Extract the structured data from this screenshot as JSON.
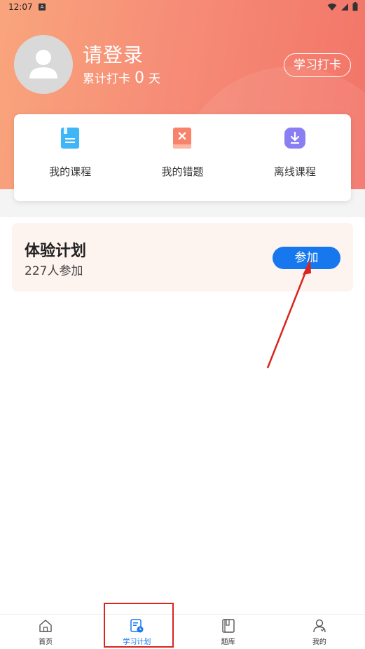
{
  "status_bar": {
    "time": "12:07",
    "notification_badge": "A"
  },
  "profile": {
    "login_text": "请登录",
    "checkin_prefix": "累计打卡",
    "checkin_count": "0",
    "checkin_suffix": "天",
    "checkin_button": "学习打卡"
  },
  "quick_actions": [
    {
      "label": "我的课程",
      "icon": "course-book-icon",
      "color": "#3fb7f7"
    },
    {
      "label": "我的错题",
      "icon": "wrong-question-icon",
      "color": "#f7836b"
    },
    {
      "label": "离线课程",
      "icon": "download-icon",
      "color": "#8a7ff2"
    }
  ],
  "plan": {
    "title": "体验计划",
    "participants": "227人参加",
    "join_button": "参加"
  },
  "bottom_nav": [
    {
      "label": "首页",
      "icon": "home-icon"
    },
    {
      "label": "学习计划",
      "icon": "study-plan-icon",
      "active": true
    },
    {
      "label": "题库",
      "icon": "question-bank-icon"
    },
    {
      "label": "我的",
      "icon": "profile-icon"
    }
  ],
  "colors": {
    "accent": "#1677ee",
    "header_start": "#f9a57c",
    "header_end": "#f27468",
    "annotation": "#d9251d"
  }
}
